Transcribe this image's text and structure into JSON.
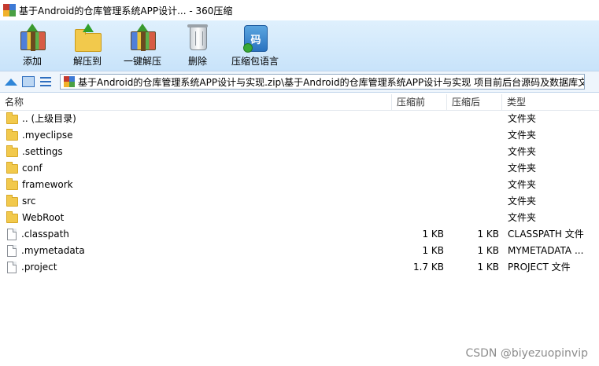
{
  "window": {
    "title": "基于Android的仓库管理系统APP设计... - 360压缩"
  },
  "toolbar": {
    "buttons": [
      {
        "label": "添加",
        "icon": "add-archive-icon"
      },
      {
        "label": "解压到",
        "icon": "extract-to-icon"
      },
      {
        "label": "一键解压",
        "icon": "one-click-extract-icon"
      },
      {
        "label": "删除",
        "icon": "delete-icon"
      },
      {
        "label": "压缩包语言",
        "icon": "archive-language-icon"
      }
    ],
    "lang_glyph": "码"
  },
  "address": {
    "path": "基于Android的仓库管理系统APP设计与实现.zip\\基于Android的仓库管理系统APP设计与实现 项目前后台源码及数据库文"
  },
  "columns": {
    "name": "名称",
    "compressed": "压缩前",
    "original": "压缩后",
    "type": "类型"
  },
  "files": [
    {
      "name": ".. (上级目录)",
      "compressed": "",
      "original": "",
      "type": "文件夹",
      "kind": "folder"
    },
    {
      "name": ".myeclipse",
      "compressed": "",
      "original": "",
      "type": "文件夹",
      "kind": "folder"
    },
    {
      "name": ".settings",
      "compressed": "",
      "original": "",
      "type": "文件夹",
      "kind": "folder"
    },
    {
      "name": "conf",
      "compressed": "",
      "original": "",
      "type": "文件夹",
      "kind": "folder"
    },
    {
      "name": "framework",
      "compressed": "",
      "original": "",
      "type": "文件夹",
      "kind": "folder"
    },
    {
      "name": "src",
      "compressed": "",
      "original": "",
      "type": "文件夹",
      "kind": "folder"
    },
    {
      "name": "WebRoot",
      "compressed": "",
      "original": "",
      "type": "文件夹",
      "kind": "folder"
    },
    {
      "name": ".classpath",
      "compressed": "1 KB",
      "original": "1 KB",
      "type": "CLASSPATH 文件",
      "kind": "file"
    },
    {
      "name": ".mymetadata",
      "compressed": "1 KB",
      "original": "1 KB",
      "type": "MYMETADATA ...",
      "kind": "file"
    },
    {
      "name": ".project",
      "compressed": "1.7 KB",
      "original": "1 KB",
      "type": "PROJECT 文件",
      "kind": "file"
    }
  ],
  "watermark": "CSDN @biyezuopinvip"
}
